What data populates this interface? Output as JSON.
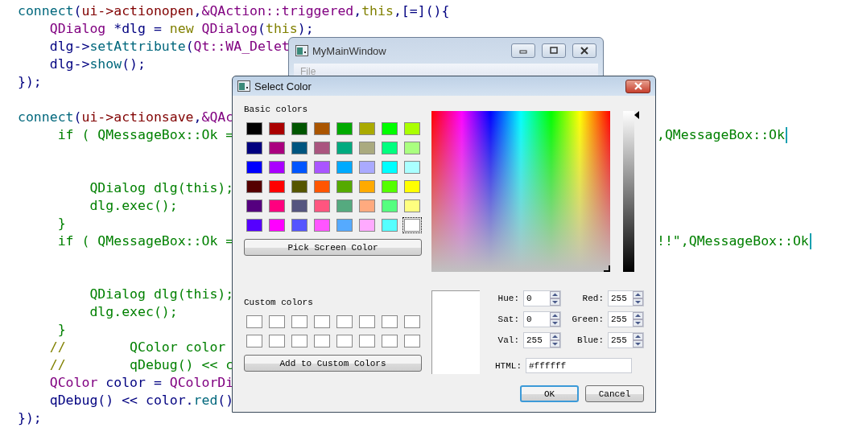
{
  "editor": {
    "lines": [
      {
        "kind": "code",
        "tokens": [
          {
            "text": "connect",
            "color": "#00677c"
          },
          {
            "text": "(",
            "color": "#000080"
          },
          {
            "text": "ui->actionopen",
            "color": "#800000"
          },
          {
            "text": ",",
            "color": "#000080"
          },
          {
            "text": "&QAction::triggered",
            "color": "#800080"
          },
          {
            "text": ",",
            "color": "#000080"
          },
          {
            "text": "this",
            "color": "#808000"
          },
          {
            "text": ",[=](){",
            "color": "#000080"
          }
        ]
      },
      {
        "kind": "code",
        "tokens": [
          {
            "text": "    QDialog",
            "color": "#800080"
          },
          {
            "text": " *dlg = ",
            "color": "#000080"
          },
          {
            "text": "new",
            "color": "#808000"
          },
          {
            "text": " QDialog",
            "color": "#800080"
          },
          {
            "text": "(",
            "color": "#000080"
          },
          {
            "text": "this",
            "color": "#808000"
          },
          {
            "text": ");",
            "color": "#000080"
          }
        ]
      },
      {
        "kind": "code",
        "tokens": [
          {
            "text": "    dlg->",
            "color": "#000080"
          },
          {
            "text": "setAttribute",
            "color": "#00677c"
          },
          {
            "text": "(",
            "color": "#000080"
          },
          {
            "text": "Qt::WA_Delet",
            "color": "#800080"
          }
        ]
      },
      {
        "kind": "code",
        "tokens": [
          {
            "text": "    dlg->",
            "color": "#000080"
          },
          {
            "text": "show",
            "color": "#00677c"
          },
          {
            "text": "();",
            "color": "#000080"
          }
        ]
      },
      {
        "kind": "code",
        "tokens": [
          {
            "text": "});",
            "color": "#000080"
          }
        ]
      },
      {
        "kind": "blank"
      },
      {
        "kind": "code",
        "tokens": [
          {
            "text": "connect",
            "color": "#00677c"
          },
          {
            "text": "(",
            "color": "#000080"
          },
          {
            "text": "ui->actionsave",
            "color": "#800000"
          },
          {
            "text": ",",
            "color": "#000080"
          },
          {
            "text": "&QAc",
            "color": "#800080"
          }
        ]
      },
      {
        "kind": "code",
        "tokens": [
          {
            "text": "     if ( QMessageBox::Ok =",
            "color": "#008000"
          }
        ],
        "tail": [
          {
            "text": ",QMessageBox::Ok",
            "color": "#008000"
          }
        ],
        "cursor": true
      },
      {
        "kind": "blank"
      },
      {
        "kind": "blank"
      },
      {
        "kind": "code",
        "tokens": [
          {
            "text": "         QDialog dlg(this);",
            "color": "#008000"
          }
        ]
      },
      {
        "kind": "code",
        "tokens": [
          {
            "text": "         dlg.exec();",
            "color": "#008000"
          }
        ]
      },
      {
        "kind": "code",
        "tokens": [
          {
            "text": "     }",
            "color": "#008000"
          }
        ]
      },
      {
        "kind": "code",
        "tokens": [
          {
            "text": "     if ( QMessageBox::Ok =",
            "color": "#008000"
          }
        ],
        "tail": [
          {
            "text": "!!\",QMessageBox::Ok",
            "color": "#008000"
          }
        ],
        "cursor": true
      },
      {
        "kind": "blank"
      },
      {
        "kind": "blank"
      },
      {
        "kind": "code",
        "tokens": [
          {
            "text": "         QDialog dlg(this);",
            "color": "#008000"
          }
        ]
      },
      {
        "kind": "code",
        "tokens": [
          {
            "text": "         dlg.exec();",
            "color": "#008000"
          }
        ]
      },
      {
        "kind": "code",
        "tokens": [
          {
            "text": "     }",
            "color": "#008000"
          }
        ]
      },
      {
        "kind": "code",
        "tokens": [
          {
            "text": "    //",
            "color": "#808000"
          },
          {
            "text": "        QColor color",
            "color": "#008000"
          }
        ]
      },
      {
        "kind": "code",
        "tokens": [
          {
            "text": "    //",
            "color": "#808000"
          },
          {
            "text": "        qDebug() << c",
            "color": "#008000"
          }
        ]
      },
      {
        "kind": "code",
        "tokens": [
          {
            "text": "    QColor",
            "color": "#800080"
          },
          {
            "text": " color = ",
            "color": "#000080"
          },
          {
            "text": "QColorDi",
            "color": "#800080"
          }
        ]
      },
      {
        "kind": "code",
        "tokens": [
          {
            "text": "    qDebug() << color.",
            "color": "#000080"
          },
          {
            "text": "red",
            "color": "#00677c"
          },
          {
            "text": "()",
            "color": "#000080"
          }
        ]
      },
      {
        "kind": "code",
        "tokens": [
          {
            "text": "});",
            "color": "#000080"
          }
        ]
      }
    ]
  },
  "main_window": {
    "title": "MyMainWindow",
    "menu": [
      {
        "label": "File",
        "disabled": true
      }
    ]
  },
  "dialog": {
    "title": "Select Color",
    "basic_colors_label": "Basic colors",
    "basic_colors": [
      {
        "color": "#000000",
        "selected": false
      },
      {
        "color": "#aa0000",
        "selected": false
      },
      {
        "color": "#005500",
        "selected": false
      },
      {
        "color": "#aa5500",
        "selected": false
      },
      {
        "color": "#00aa00",
        "selected": false
      },
      {
        "color": "#aaaa00",
        "selected": false
      },
      {
        "color": "#00ff00",
        "selected": false
      },
      {
        "color": "#aaff00",
        "selected": false
      },
      {
        "color": "#00007f",
        "selected": false
      },
      {
        "color": "#aa007f",
        "selected": false
      },
      {
        "color": "#00557f",
        "selected": false
      },
      {
        "color": "#aa557f",
        "selected": false
      },
      {
        "color": "#00aa7f",
        "selected": false
      },
      {
        "color": "#aaaa7f",
        "selected": false
      },
      {
        "color": "#00ff7f",
        "selected": false
      },
      {
        "color": "#aaff7f",
        "selected": false
      },
      {
        "color": "#0000ff",
        "selected": false
      },
      {
        "color": "#aa00ff",
        "selected": false
      },
      {
        "color": "#0055ff",
        "selected": false
      },
      {
        "color": "#aa55ff",
        "selected": false
      },
      {
        "color": "#00aaff",
        "selected": false
      },
      {
        "color": "#aaaaff",
        "selected": false
      },
      {
        "color": "#00ffff",
        "selected": false
      },
      {
        "color": "#aaffff",
        "selected": false
      },
      {
        "color": "#550000",
        "selected": false
      },
      {
        "color": "#ff0000",
        "selected": false
      },
      {
        "color": "#555500",
        "selected": false
      },
      {
        "color": "#ff5500",
        "selected": false
      },
      {
        "color": "#55aa00",
        "selected": false
      },
      {
        "color": "#ffaa00",
        "selected": false
      },
      {
        "color": "#55ff00",
        "selected": false
      },
      {
        "color": "#ffff00",
        "selected": false
      },
      {
        "color": "#55007f",
        "selected": false
      },
      {
        "color": "#ff007f",
        "selected": false
      },
      {
        "color": "#55557f",
        "selected": false
      },
      {
        "color": "#ff557f",
        "selected": false
      },
      {
        "color": "#55aa7f",
        "selected": false
      },
      {
        "color": "#ffaa7f",
        "selected": false
      },
      {
        "color": "#55ff7f",
        "selected": false
      },
      {
        "color": "#ffff7f",
        "selected": false
      },
      {
        "color": "#5500ff",
        "selected": false
      },
      {
        "color": "#ff00ff",
        "selected": false
      },
      {
        "color": "#5555ff",
        "selected": false
      },
      {
        "color": "#ff55ff",
        "selected": false
      },
      {
        "color": "#55aaff",
        "selected": false
      },
      {
        "color": "#ffaaff",
        "selected": false
      },
      {
        "color": "#55ffff",
        "selected": false
      },
      {
        "color": "#ffffff",
        "selected": true
      }
    ],
    "pick_button": "Pick Screen Color",
    "custom_colors_label": "Custom colors",
    "custom_colors": [
      {
        "color": "#ffffff"
      },
      {
        "color": "#ffffff"
      },
      {
        "color": "#ffffff"
      },
      {
        "color": "#ffffff"
      },
      {
        "color": "#ffffff"
      },
      {
        "color": "#ffffff"
      },
      {
        "color": "#ffffff"
      },
      {
        "color": "#ffffff"
      },
      {
        "color": "#ffffff"
      },
      {
        "color": "#ffffff"
      },
      {
        "color": "#ffffff"
      },
      {
        "color": "#ffffff"
      },
      {
        "color": "#ffffff"
      },
      {
        "color": "#ffffff"
      },
      {
        "color": "#ffffff"
      },
      {
        "color": "#ffffff"
      }
    ],
    "add_button": "Add to Custom Colors",
    "luminance": {
      "level": 1
    },
    "preview": {
      "color": "#ffffff"
    },
    "fields": [
      {
        "label": "Hue:",
        "value": "0"
      },
      {
        "label": "Red:",
        "value": "255"
      },
      {
        "label": "Sat:",
        "value": "0"
      },
      {
        "label": "Green:",
        "value": "255"
      },
      {
        "label": "Val:",
        "value": "255"
      },
      {
        "label": "Blue:",
        "value": "255"
      }
    ],
    "html": {
      "label": "HTML:",
      "value": "#ffffff"
    },
    "buttons": [
      {
        "label": "OK",
        "default": true
      },
      {
        "label": "Cancel",
        "default": false
      }
    ]
  }
}
